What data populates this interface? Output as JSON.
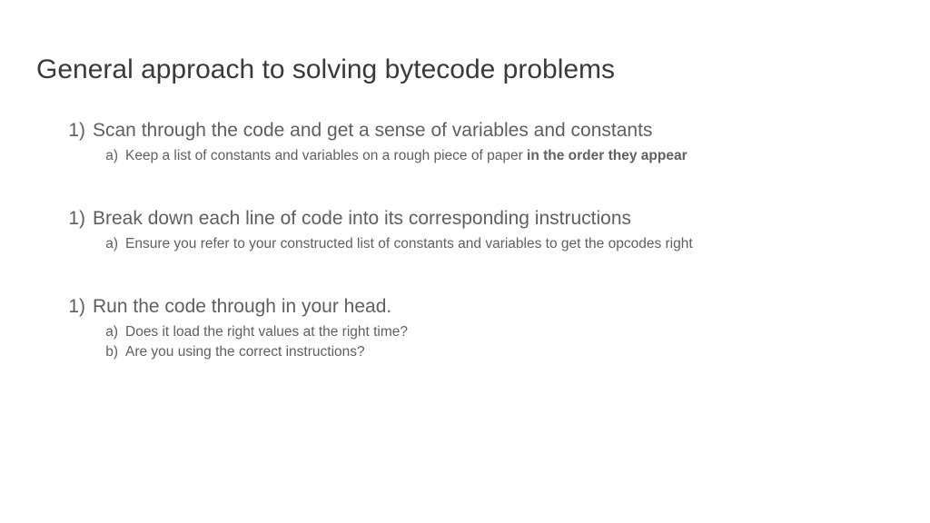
{
  "title": "General approach to solving bytecode problems",
  "items": [
    {
      "marker": "1)",
      "text": "Scan through the code and get a sense of variables and constants",
      "subs": [
        {
          "marker": "a)",
          "text": "Keep a list of constants and variables on a rough piece of paper ",
          "bold": "in the order they appear"
        }
      ]
    },
    {
      "marker": "1)",
      "text": "Break down each line of code into its corresponding instructions",
      "subs": [
        {
          "marker": "a)",
          "text": "Ensure you refer to your constructed list of constants and variables to get the opcodes right",
          "bold": ""
        }
      ]
    },
    {
      "marker": "1)",
      "text": "Run the code through in your head.",
      "subs": [
        {
          "marker": "a)",
          "text": "Does it load the right values at the right time?",
          "bold": ""
        },
        {
          "marker": "b)",
          "text": "Are you using the correct instructions?",
          "bold": ""
        }
      ]
    }
  ]
}
